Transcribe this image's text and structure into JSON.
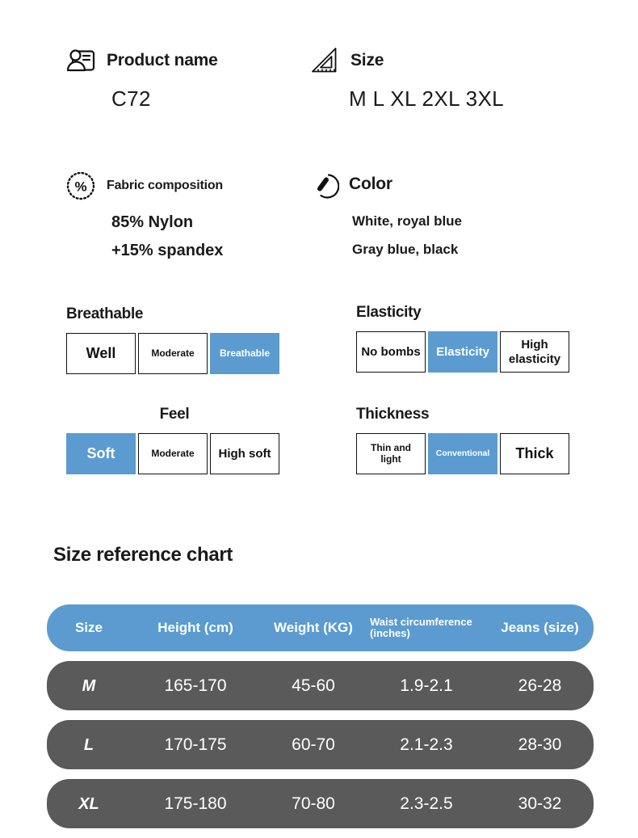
{
  "theme": {
    "accent_blue": "#5B9BD0",
    "row_gray": "#5A5A5A",
    "text_dark": "#111111",
    "background": "#FFFFFF"
  },
  "features": [
    {
      "icon": "id-card-icon",
      "title": "Product name",
      "value": "C72"
    },
    {
      "icon": "set-square-ruler-icon",
      "title": "Size",
      "value": "M L XL 2XL 3XL"
    },
    {
      "icon": "percent-circle-icon",
      "title": "Fabric composition",
      "value_line1": "85% Nylon",
      "value_line2": "+15% spandex"
    },
    {
      "icon": "color-swatch-icon",
      "title": "Color",
      "value_line1": "White, royal blue",
      "value_line2": "Gray blue, black"
    }
  ],
  "attributes": [
    {
      "label": "Breathable",
      "options": [
        {
          "text": "Well",
          "selected": false
        },
        {
          "text": "Moderate",
          "selected": false
        },
        {
          "text": "Breathable",
          "selected": true
        }
      ]
    },
    {
      "label": "Elasticity",
      "options": [
        {
          "text": "No bombs",
          "selected": false
        },
        {
          "text": "Elasticity",
          "selected": true
        },
        {
          "text": "High elasticity",
          "selected": false
        }
      ]
    },
    {
      "label": "Feel",
      "options": [
        {
          "text": "Soft",
          "selected": true
        },
        {
          "text": "Moderate",
          "selected": false
        },
        {
          "text": "High soft",
          "selected": false
        }
      ]
    },
    {
      "label": "Thickness",
      "options": [
        {
          "text": "Thin and light",
          "selected": false
        },
        {
          "text": "Conventional",
          "selected": true
        },
        {
          "text": "Thick",
          "selected": false
        }
      ]
    }
  ],
  "size_chart": {
    "title": "Size reference chart",
    "columns": [
      "Size",
      "Height (cm)",
      "Weight (KG)",
      "Waist circumference (inches)",
      "Jeans (size)"
    ],
    "rows": [
      {
        "size": "M",
        "height": "165-170",
        "weight": "45-60",
        "waist": "1.9-2.1",
        "jeans": "26-28"
      },
      {
        "size": "L",
        "height": "170-175",
        "weight": "60-70",
        "waist": "2.1-2.3",
        "jeans": "28-30"
      },
      {
        "size": "XL",
        "height": "175-180",
        "weight": "70-80",
        "waist": "2.3-2.5",
        "jeans": "30-32"
      }
    ]
  }
}
